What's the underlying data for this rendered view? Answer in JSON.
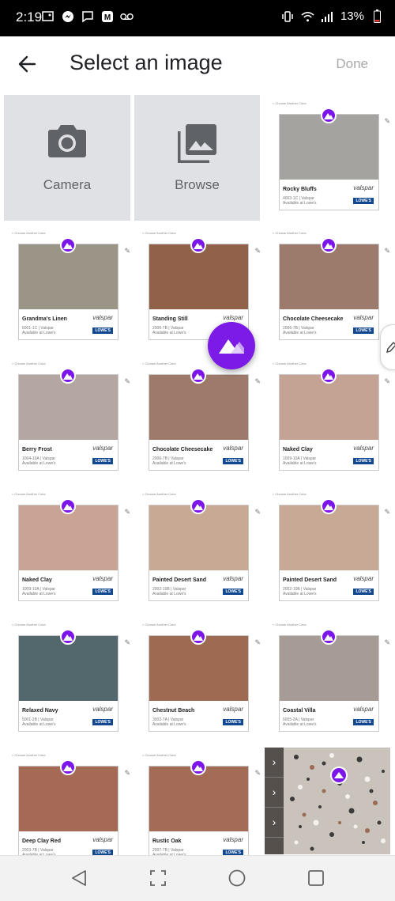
{
  "status_bar": {
    "time": "2:19",
    "battery": "13%"
  },
  "header": {
    "title": "Select an image",
    "done_label": "Done"
  },
  "sources": {
    "camera_label": "Camera",
    "browse_label": "Browse"
  },
  "choose_text": "< Choose Another Color",
  "vendor": {
    "brand": "valspar",
    "store": "LOWE'S"
  },
  "colors": [
    {
      "name": "Rocky Bluffs",
      "code": "4003-1C | Valspar",
      "avail": "Available at Lowe's",
      "hex": "#a4a39f"
    },
    {
      "name": "Grandma's Linen",
      "code": "6001-1C | Valspar",
      "avail": "Available at Lowe's",
      "hex": "#9b9587"
    },
    {
      "name": "Standing Still",
      "code": "2006-7B | Valspar",
      "avail": "Available at Lowe's",
      "hex": "#91614a"
    },
    {
      "name": "Chocolate Cheesecake",
      "code": "2006-7B | Valspar",
      "avail": "Available at Lowe's",
      "hex": "#9c7b6c"
    },
    {
      "name": "Berry Frost",
      "code": "1004-10A | Valspar",
      "avail": "Available at Lowe's",
      "hex": "#b4a7a2"
    },
    {
      "name": "Chocolate Cheesecake",
      "code": "2006-7B | Valspar",
      "avail": "Available at Lowe's",
      "hex": "#9d7a6a"
    },
    {
      "name": "Naked Clay",
      "code": "1009-10A | Valspar",
      "avail": "Available at Lowe's",
      "hex": "#c4a394"
    },
    {
      "name": "Naked Clay",
      "code": "1009-10A | Valspar",
      "avail": "Available at Lowe's",
      "hex": "#c9a494"
    },
    {
      "name": "Painted Desert Sand",
      "code": "2002-10B | Valspar",
      "avail": "Available at Lowe's",
      "hex": "#c7a994"
    },
    {
      "name": "Painted Desert Sand",
      "code": "2002-10B | Valspar",
      "avail": "Available at Lowe's",
      "hex": "#c8a996"
    },
    {
      "name": "Relaxed Navy",
      "code": "5001-2B | Valspar",
      "avail": "Available at Lowe's",
      "hex": "#52686d"
    },
    {
      "name": "Chestnut Beach",
      "code": "3002-7A | Valspar",
      "avail": "Available at Lowe's",
      "hex": "#9f6a52"
    },
    {
      "name": "Coastal Villa",
      "code": "6005-2A | Valspar",
      "avail": "Available at Lowe's",
      "hex": "#a69c95"
    },
    {
      "name": "Deep Clay Red",
      "code": "2003-7B | Valspar",
      "avail": "Available at Lowe's",
      "hex": "#a56a56"
    },
    {
      "name": "Rustic Oak",
      "code": "2007-7B | Valspar",
      "avail": "Available at Lowe's",
      "hex": "#a46c56"
    }
  ],
  "theme": {
    "accent": "#7b15e9",
    "status_bar": "#000000",
    "source_tile": "#e0e1e4"
  },
  "icons": [
    "back-arrow-icon",
    "camera-icon",
    "gallery-icon",
    "pencil-icon",
    "nav-back-icon",
    "nav-recents-icon",
    "nav-home-icon",
    "nav-overview-icon"
  ]
}
